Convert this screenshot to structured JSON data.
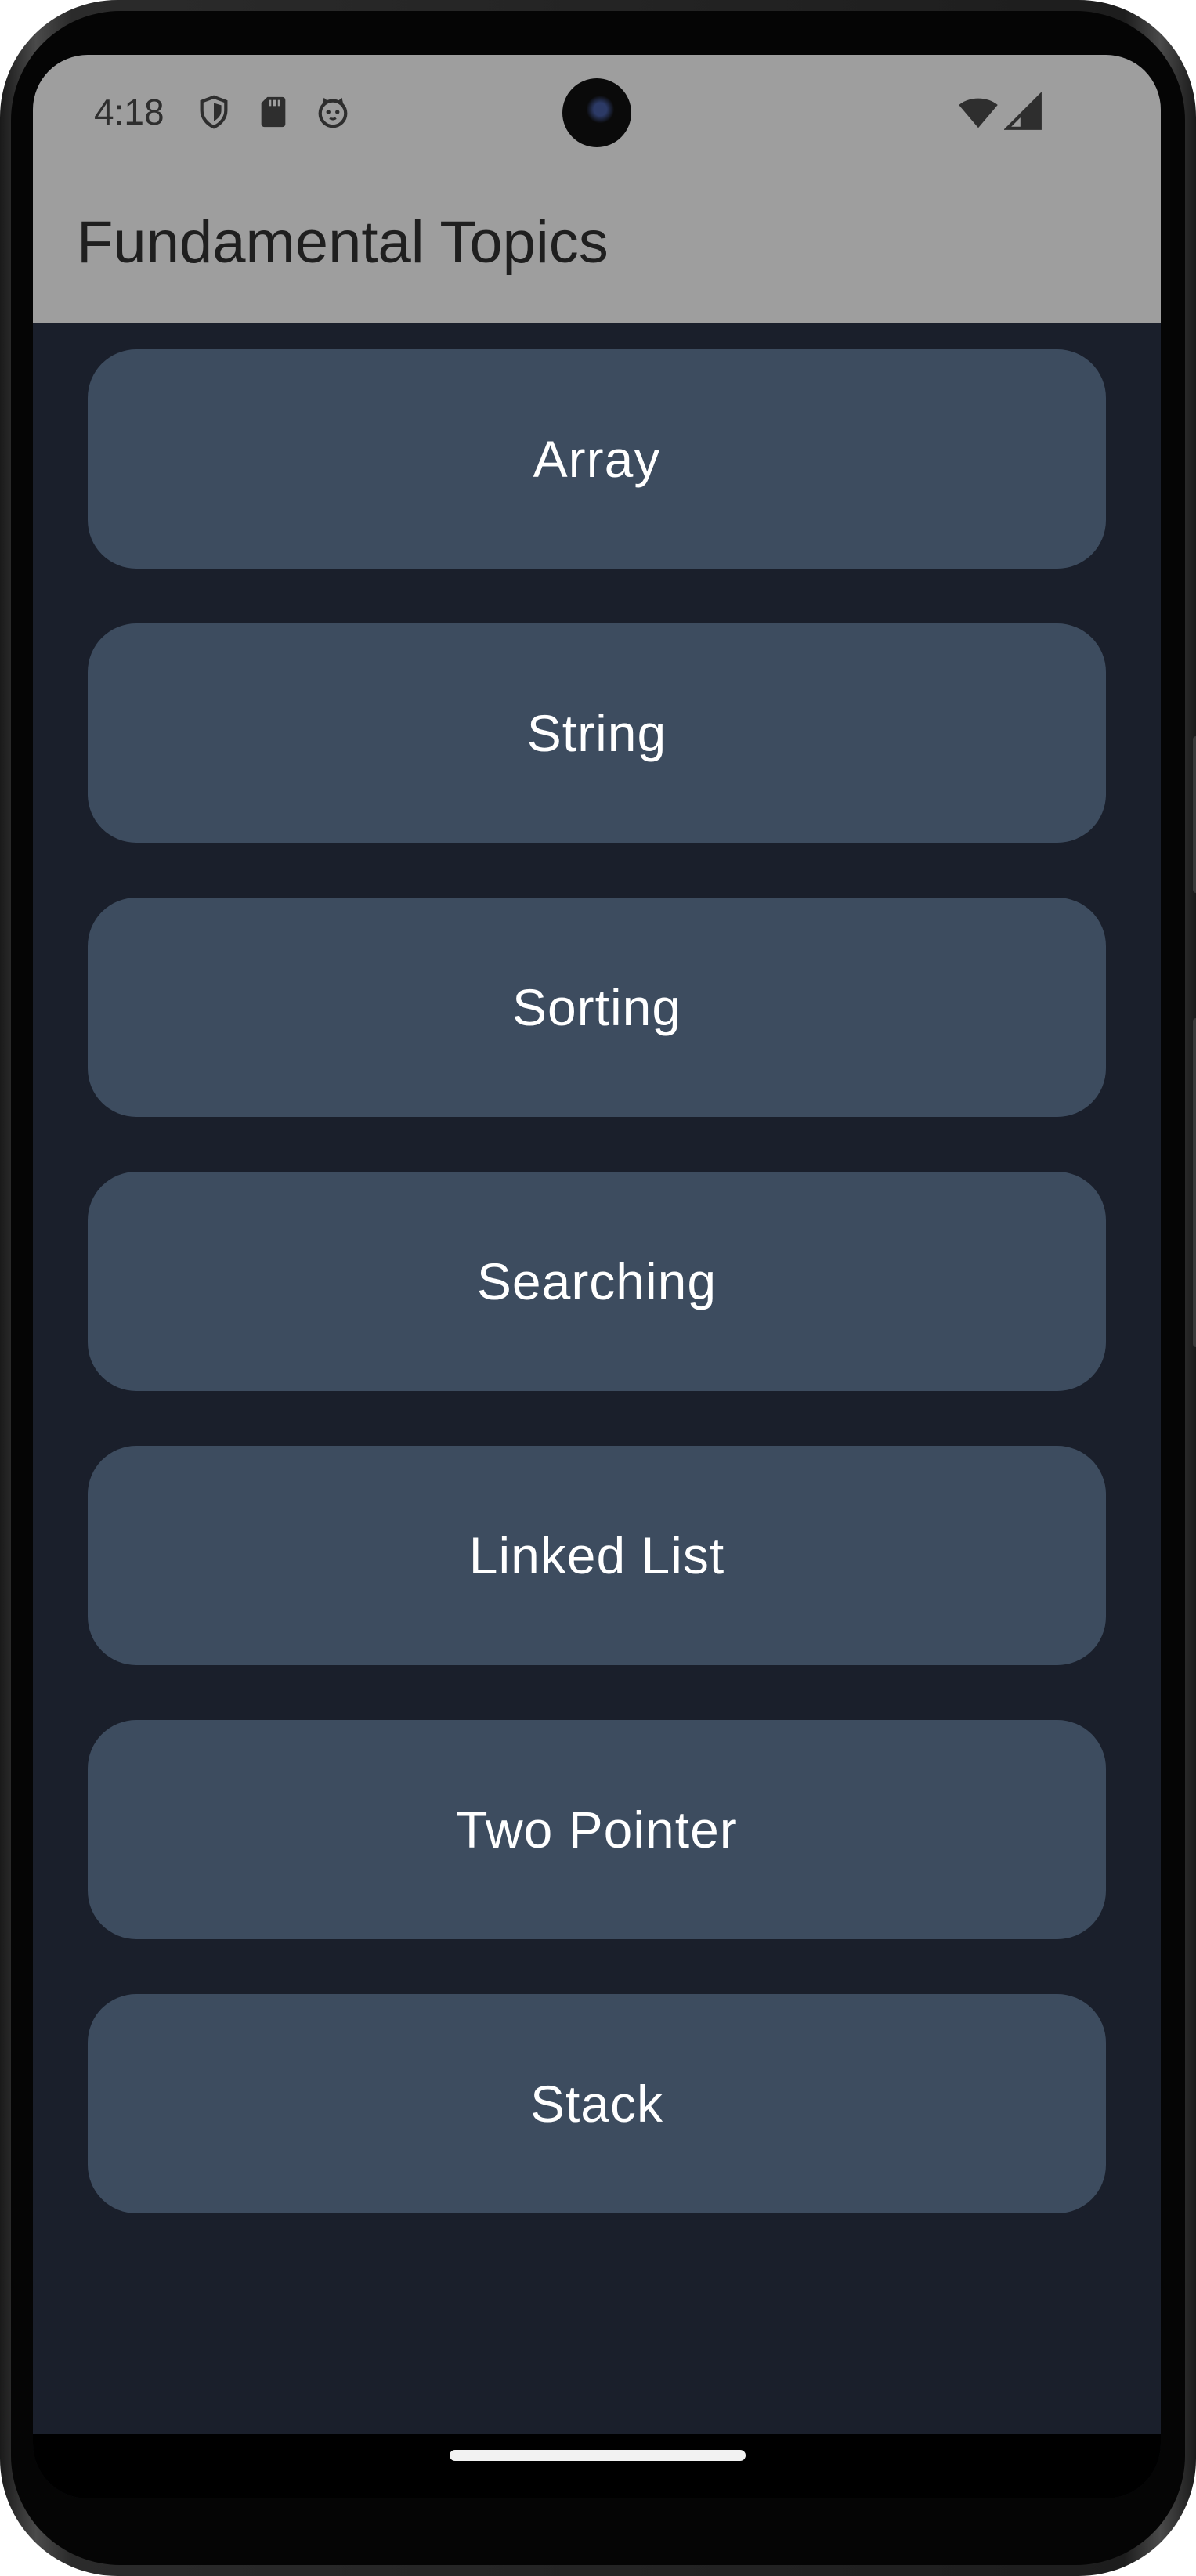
{
  "status_bar": {
    "time": "4:18",
    "left_icons": [
      "shield-icon",
      "sd-card-icon",
      "cat-face-icon"
    ],
    "right_icons": [
      "wifi-icon",
      "cellular-signal-icon"
    ]
  },
  "app_bar": {
    "title": "Fundamental Topics"
  },
  "topics": [
    {
      "label": "Array"
    },
    {
      "label": "String"
    },
    {
      "label": "Sorting"
    },
    {
      "label": "Searching"
    },
    {
      "label": "Linked List"
    },
    {
      "label": "Two Pointer"
    },
    {
      "label": "Stack"
    }
  ],
  "colors": {
    "app_bar_bg": "#9e9e9e",
    "content_bg": "#1a1f2b",
    "card_bg": "#3d4c5f",
    "card_text": "#ffffff"
  }
}
